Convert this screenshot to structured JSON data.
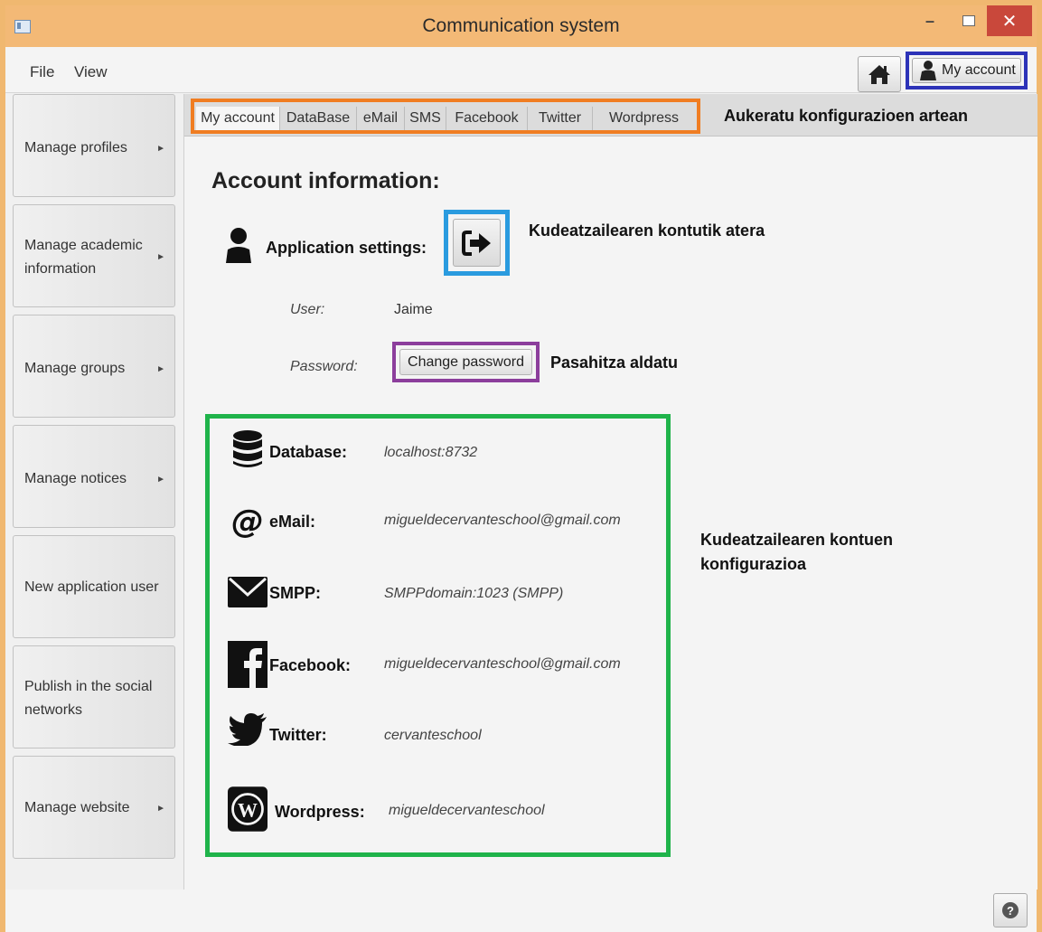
{
  "window": {
    "title": "Communication system",
    "minimize": "–",
    "close": "✕"
  },
  "menu": {
    "file": "File",
    "view": "View"
  },
  "toolbar": {
    "my_account": "My account"
  },
  "sidebar": {
    "items": [
      {
        "label": "Manage profiles",
        "arrow": "►"
      },
      {
        "label": "Manage academic\ninformation",
        "arrow": "►"
      },
      {
        "label": "Manage groups",
        "arrow": "►"
      },
      {
        "label": "Manage notices",
        "arrow": "►"
      },
      {
        "label": "New application user",
        "arrow": ""
      },
      {
        "label": "Publish in the social\nnetworks",
        "arrow": ""
      },
      {
        "label": "Manage website",
        "arrow": "►"
      }
    ]
  },
  "tabs": {
    "items": [
      "My account",
      "DataBase",
      "eMail",
      "SMS",
      "Facebook",
      "Twitter",
      "Wordpress"
    ],
    "active_index": 0,
    "note": "Aukeratu konfigurazioen artean"
  },
  "account": {
    "heading": "Account information:",
    "app_settings_label": "Application settings:",
    "logout_note": "Kudeatzailearen kontutik atera",
    "user_label": "User:",
    "user_value": "Jaime",
    "password_label": "Password:",
    "change_password": "Change password",
    "password_note": "Pasahitza aldatu"
  },
  "config": {
    "note": "Kudeatzailearen kontuen\nkonfigurazioa",
    "items": [
      {
        "icon": "database-icon",
        "label": "Database:",
        "value": "localhost:8732"
      },
      {
        "icon": "at-sign-icon",
        "label": "eMail:",
        "value": "migueldecervanteschool@gmail.com"
      },
      {
        "icon": "envelope-icon",
        "label": "SMPP:",
        "value": "SMPPdomain:1023  (SMPP)"
      },
      {
        "icon": "facebook-icon",
        "label": "Facebook:",
        "value": "migueldecervanteschool@gmail.com"
      },
      {
        "icon": "twitter-icon",
        "label": "Twitter:",
        "value": "cervanteschool"
      },
      {
        "icon": "wordpress-icon",
        "label": "Wordpress:",
        "value": "migueldecervanteschool"
      }
    ]
  },
  "colors": {
    "window_border": "#f0b870",
    "tabs_highlight": "#f07d22",
    "account_highlight": "#2d33b8",
    "logout_highlight": "#2a9bdf",
    "password_highlight": "#8c3e9c",
    "config_highlight": "#1fb34a"
  }
}
